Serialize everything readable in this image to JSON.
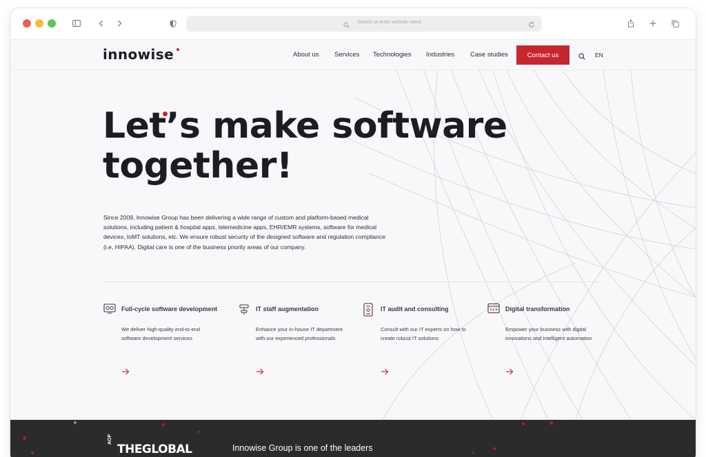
{
  "browser": {
    "address_placeholder": "Search or enter website name"
  },
  "nav": {
    "logo": "innowise",
    "links": [
      "About us",
      "Services",
      "Technologies",
      "Industries",
      "Case studies"
    ],
    "contact": "Contact us",
    "lang": "EN"
  },
  "hero": {
    "headline_line1": "Let’s make software",
    "headline_line2": "together!",
    "intro": "Since 2009, Innowise Group has been delivering a wide range of custom and platform-based medical solutions, including patient & hospital apps, telemedicine apps, EHR/EMR systems, software for medical devices, IoMT solutions, etc. We ensure robust security of the designed software and regulation compliance (i.e, HIPAA).  Digital care is one of the business priority areas of our company."
  },
  "services": [
    {
      "icon": "software-development-icon",
      "title": "Full-cycle software development",
      "desc": "We deliver high-quality end-to-end software development services"
    },
    {
      "icon": "staff-augmentation-icon",
      "title": "IT staff augmentation",
      "desc": "Enhance your in-house IT department with our experienced professionals"
    },
    {
      "icon": "audit-consulting-icon",
      "title": "IT audit and consulting",
      "desc": "Consult with our IT experts on how to create robust IT solutions"
    },
    {
      "icon": "digital-transformation-icon",
      "title": "Digital transformation",
      "desc": "Empower your business with digital innovations and intelligent automation"
    }
  ],
  "band": {
    "badge_vertical": "AOP",
    "badge_title": "THEGLOBAL",
    "text": "Innowise Group is one of the leaders"
  },
  "colors": {
    "accent": "#c8262f",
    "dark_band": "#2b2b2e",
    "page_bg": "#f8f8fa"
  }
}
